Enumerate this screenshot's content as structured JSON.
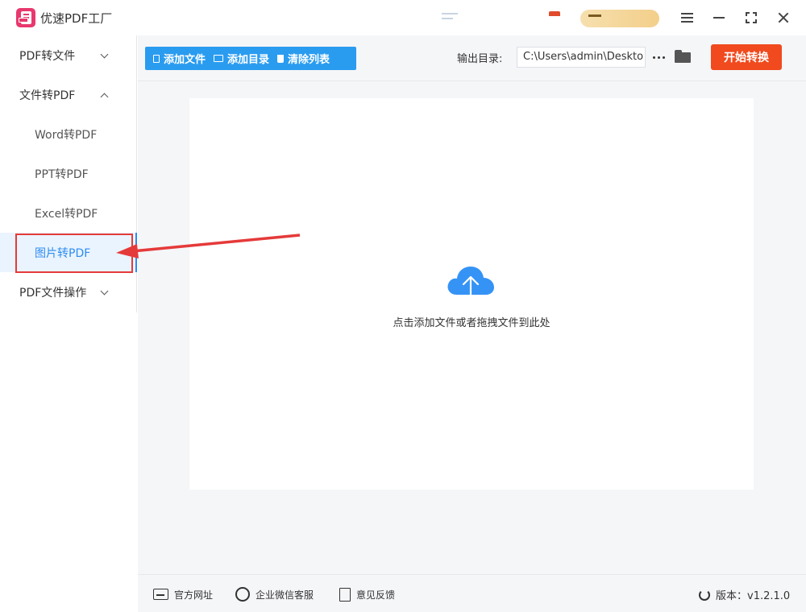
{
  "app": {
    "title": "优速PDF工厂"
  },
  "sidebar": {
    "items": [
      {
        "label": "PDF转文件"
      },
      {
        "label": "文件转PDF"
      },
      {
        "label": "Word转PDF"
      },
      {
        "label": "PPT转PDF"
      },
      {
        "label": "Excel转PDF"
      },
      {
        "label": "图片转PDF"
      },
      {
        "label": "PDF文件操作"
      }
    ]
  },
  "toolbar": {
    "add_file": "添加文件",
    "add_folder": "添加目录",
    "clear_list": "清除列表",
    "output_label": "输出目录:",
    "output_path": "C:\\Users\\admin\\Deskto",
    "start": "开始转换"
  },
  "dropzone": {
    "text": "点击添加文件或者拖拽文件到此处"
  },
  "footer": {
    "website": "官方网址",
    "wechat": "企业微信客服",
    "feedback": "意见反馈",
    "version": "版本：v1.2.1.0"
  },
  "colors": {
    "accent": "#2a9cf0",
    "start_button": "#f04a1e",
    "highlight": "#e53a3a",
    "active_item": "#2d8cf0"
  }
}
